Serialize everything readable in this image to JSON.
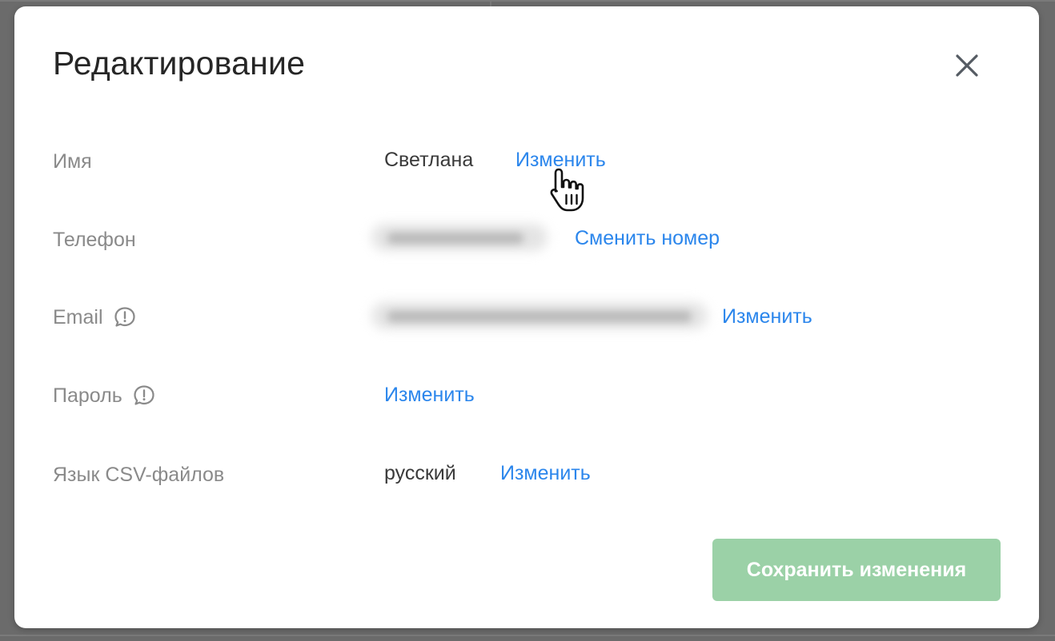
{
  "dialog": {
    "title": "Редактирование",
    "close_icon": "close-icon"
  },
  "fields": {
    "name": {
      "label": "Имя",
      "value": "Светлана",
      "action": "Изменить"
    },
    "phone": {
      "label": "Телефон",
      "value_hidden": true,
      "action": "Сменить номер"
    },
    "email": {
      "label": "Email",
      "info_icon": "info-bubble-icon",
      "value_hidden": true,
      "action": "Изменить"
    },
    "password": {
      "label": "Пароль",
      "info_icon": "info-bubble-icon",
      "action": "Изменить"
    },
    "csv_language": {
      "label": "Язык CSV-файлов",
      "value": "русский",
      "action": "Изменить"
    }
  },
  "footer": {
    "save_label": "Сохранить изменения"
  },
  "colors": {
    "link": "#2b86ec",
    "save_button_disabled": "#9bd1a7",
    "label": "#8a8a8a"
  }
}
